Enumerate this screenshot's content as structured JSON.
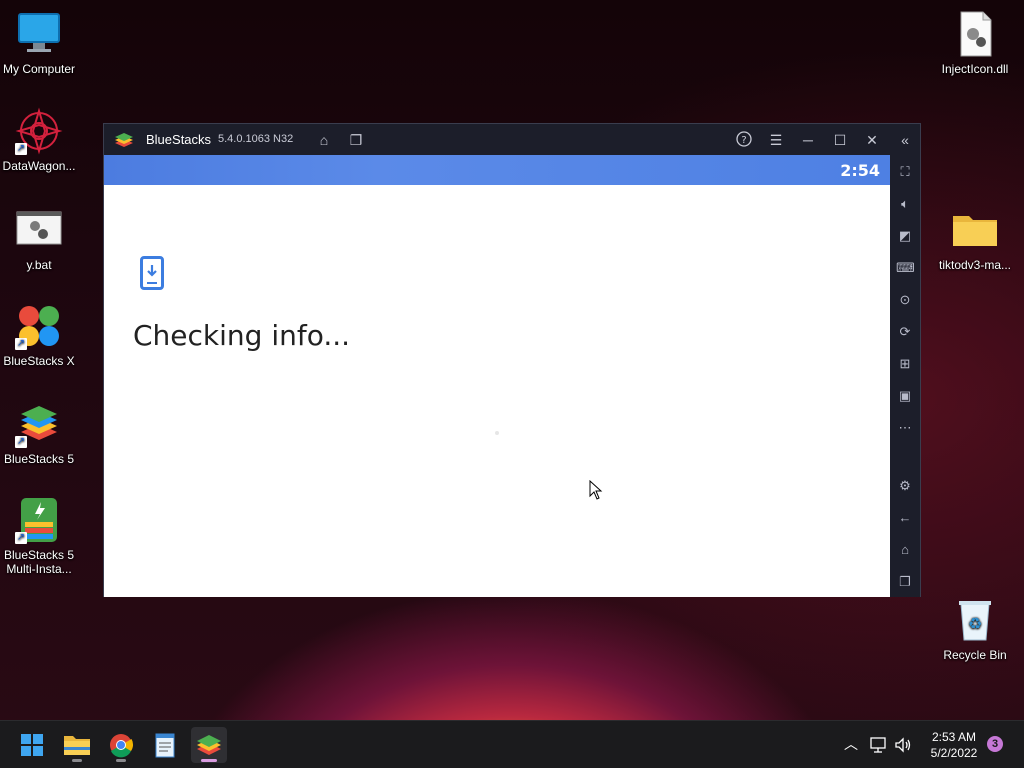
{
  "desktop": {
    "icons": {
      "my_computer": "My Computer",
      "datawagon": "DataWagon...",
      "ybat": "y.bat",
      "bluestacks_x": "BlueStacks X",
      "bluestacks_5": "BlueStacks 5",
      "bluestacks_multi_line1": "BlueStacks 5",
      "bluestacks_multi_line2": "Multi-Insta...",
      "injecticon": "InjectIcon.dll",
      "tiktod": "tiktodv3-ma...",
      "recycle_bin": "Recycle Bin"
    }
  },
  "window": {
    "title": "BlueStacks",
    "version": "5.4.0.1063 N32",
    "titlebar_icons": [
      "home-icon",
      "multi-instance-icon",
      "help-icon",
      "menu-icon",
      "minimize-icon",
      "maximize-icon",
      "close-icon",
      "collapse-sidebar-icon"
    ],
    "android": {
      "status_time": "2:54",
      "message": "Checking info..."
    },
    "sidebar_icons": [
      "fullscreen-icon",
      "volume-icon",
      "pointer-icon",
      "keyboard-icon",
      "macro-icon",
      "rotate-icon",
      "gamepad-icon",
      "apk-icon",
      "more-icon",
      "settings-icon",
      "back-icon",
      "android-home-icon",
      "recent-apps-icon"
    ]
  },
  "taskbar": {
    "apps": [
      "start-icon",
      "file-explorer-icon",
      "chrome-icon",
      "notepad-icon",
      "bluestacks-icon"
    ],
    "clock_time": "2:53 AM",
    "clock_date": "5/2/2022",
    "notification_count": "3"
  },
  "colors": {
    "accent": "#4c7ce0",
    "window_bg": "#1c1e2a",
    "taskbar_bg": "#1b1b1d"
  }
}
